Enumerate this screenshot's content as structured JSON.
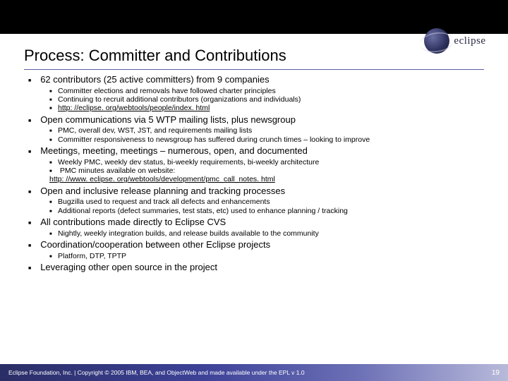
{
  "logo": {
    "text": "eclipse"
  },
  "title": "Process: Committer and Contributions",
  "bullets": [
    {
      "text": "62 contributors (25 active committers) from 9 companies",
      "sub": [
        {
          "text": "Committer elections and removals have followed charter principles"
        },
        {
          "text": "Continuing to recruit additional contributors (organizations and individuals)"
        },
        {
          "text": "http: //eclipse. org/webtools/people/index. html",
          "link": true
        }
      ]
    },
    {
      "text": "Open communications via 5 WTP mailing lists, plus newsgroup",
      "sub": [
        {
          "text": "PMC, overall dev, WST, JST, and requirements mailing lists"
        },
        {
          "text": "Committer responsiveness to newsgroup has suffered during crunch times – looking to improve"
        }
      ]
    },
    {
      "text": "Meetings, meeting, meetings – numerous, open, and documented",
      "sub": [
        {
          "text": "Weekly PMC, weekly dev status, bi-weekly requirements, bi-weekly architecture"
        },
        {
          "text": "PMC minutes available on website:",
          "trail_link": "http: //www. eclipse. org/webtools/development/pmc_call_notes. html"
        }
      ]
    },
    {
      "text": "Open and inclusive release planning and tracking processes",
      "sub": [
        {
          "text": "Bugzilla used to request and track all defects and enhancements"
        },
        {
          "text": "Additional reports (defect summaries, test stats, etc) used to enhance planning / tracking"
        }
      ]
    },
    {
      "text": "All contributions made directly to Eclipse CVS",
      "sub": [
        {
          "text": "Nightly, weekly integration builds, and release builds available to the community"
        }
      ]
    },
    {
      "text": "Coordination/cooperation between other Eclipse projects",
      "sub": [
        {
          "text": "Platform, DTP, TPTP"
        }
      ]
    },
    {
      "text": "Leveraging other open source in the project",
      "sub": []
    }
  ],
  "footer": {
    "text": "Eclipse Foundation, Inc. | Copyright © 2005 IBM, BEA, and ObjectWeb and made available under the EPL v 1.0",
    "page": "19"
  }
}
